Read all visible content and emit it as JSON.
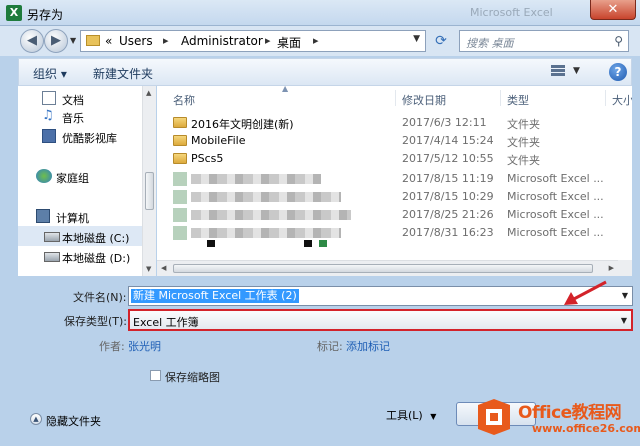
{
  "window": {
    "title": "另存为",
    "title_ghost": "Microsoft Excel",
    "close_glyph": "✕"
  },
  "address": {
    "crumbs": [
      "«",
      "Users",
      "Administrator",
      "桌面"
    ],
    "search_placeholder": "搜索 桌面"
  },
  "toolbar": {
    "organize": "组织 ▾",
    "new_folder": "新建文件夹",
    "help": "?"
  },
  "nav": {
    "items": [
      {
        "label": "文档",
        "icon": "document-icon"
      },
      {
        "label": "音乐",
        "icon": "music-icon"
      },
      {
        "label": "优酷影视库",
        "icon": "video-library-icon"
      },
      {
        "label": "家庭组",
        "icon": "homegroup-icon"
      },
      {
        "label": "计算机",
        "icon": "computer-icon"
      },
      {
        "label": "本地磁盘 (C:)",
        "icon": "drive-icon"
      },
      {
        "label": "本地磁盘 (D:)",
        "icon": "drive-icon"
      }
    ],
    "selected_index": 5
  },
  "filelist": {
    "columns": [
      "名称",
      "修改日期",
      "类型",
      "大小"
    ],
    "rows": [
      {
        "name": "2016年文明创建(新)",
        "date": "2017/6/3 12:11",
        "type": "文件夹",
        "kind": "folder"
      },
      {
        "name": "MobileFile",
        "date": "2017/4/14 15:24",
        "type": "文件夹",
        "kind": "folder"
      },
      {
        "name": "PScs5",
        "date": "2017/5/12 10:55",
        "type": "文件夹",
        "kind": "folder"
      },
      {
        "name": "",
        "date": "2017/8/15 11:19",
        "type": "Microsoft Excel ...",
        "kind": "blurred"
      },
      {
        "name": "",
        "date": "2017/8/15 10:29",
        "type": "Microsoft Excel ...",
        "kind": "blurred"
      },
      {
        "name": "",
        "date": "2017/8/25 21:26",
        "type": "Microsoft Excel ...",
        "kind": "blurred"
      },
      {
        "name": "",
        "date": "2017/8/31 16:23",
        "type": "Microsoft Excel ...",
        "kind": "blurred"
      }
    ]
  },
  "form": {
    "filename_label": "文件名(N):",
    "filename_value": "新建 Microsoft Excel 工作表 (2)",
    "filetype_label": "保存类型(T):",
    "filetype_value": "Excel 工作簿",
    "author_label": "作者:",
    "author_value": "张光明",
    "tags_label": "标记:",
    "tags_value": "添加标记",
    "thumbnail_label": "保存缩略图"
  },
  "footer": {
    "hide_folders": "隐藏文件夹",
    "tools": "工具(L)",
    "tools_arrow": "▼"
  },
  "watermark": {
    "brand": "Office教程网",
    "url": "www.office26.com"
  },
  "colors": {
    "highlight_box": "#d3232a",
    "selection": "#3399ff",
    "link": "#1f5fb5",
    "brand": "#e85a1c"
  }
}
